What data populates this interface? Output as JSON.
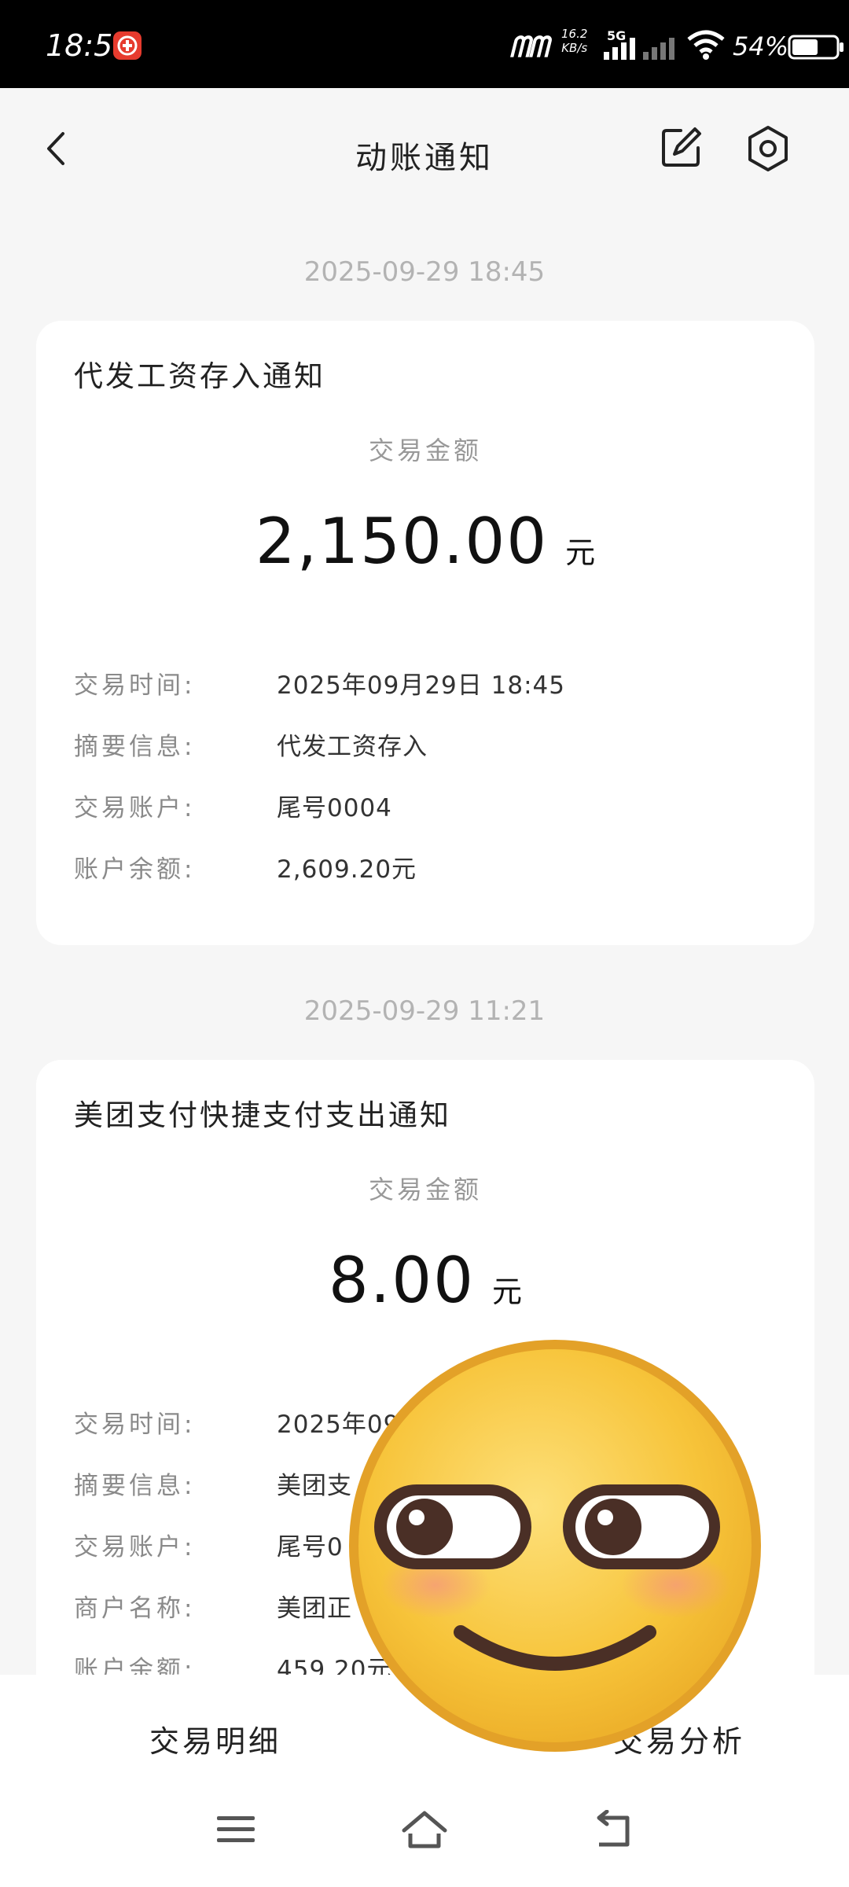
{
  "status_bar": {
    "time": "18:56",
    "app_badge": "银行",
    "network_logo": "ᗰᗰ",
    "speed_value": "16.2",
    "speed_unit": "KB/s",
    "network_type": "5G",
    "battery": "54%"
  },
  "header": {
    "title": "动账通知"
  },
  "notifications": [
    {
      "timestamp": "2025-09-29 18:45",
      "title": "代发工资存入通知",
      "amount_caption": "交易金额",
      "amount": "2,150.00",
      "unit": "元",
      "fields": [
        {
          "label": "交易时间:",
          "value": "2025年09月29日 18:45"
        },
        {
          "label": "摘要信息:",
          "value": "代发工资存入"
        },
        {
          "label": "交易账户:",
          "value": "尾号0004"
        },
        {
          "label": "账户余额:",
          "value": "2,609.20元"
        }
      ]
    },
    {
      "timestamp": "2025-09-29 11:21",
      "title": "美团支付快捷支付支出通知",
      "amount_caption": "交易金额",
      "amount": "8.00",
      "unit": "元",
      "fields": [
        {
          "label": "交易时间:",
          "value": "2025年09"
        },
        {
          "label": "摘要信息:",
          "value": "美团支"
        },
        {
          "label": "交易账户:",
          "value": "尾号0"
        },
        {
          "label": "商户名称:",
          "value": "美团正"
        },
        {
          "label": "账户余额:",
          "value": "459.20元"
        }
      ]
    }
  ],
  "bottom_tabs": {
    "detail": "交易明细",
    "analysis": "交易分析"
  },
  "icons": {
    "back": "back-arrow-icon",
    "edit": "edit-icon",
    "settings": "settings-icon",
    "nav_menu": "menu-icon",
    "nav_home": "home-icon",
    "nav_back": "back-icon",
    "sticker": "smiling-emoji-sticker"
  },
  "colors": {
    "background": "#f6f6f6",
    "card": "#ffffff",
    "timestamp": "#b3b3b3",
    "label": "#8a8a8a",
    "sticker_face": "#f7c43a",
    "sticker_border": "#e3a128"
  }
}
